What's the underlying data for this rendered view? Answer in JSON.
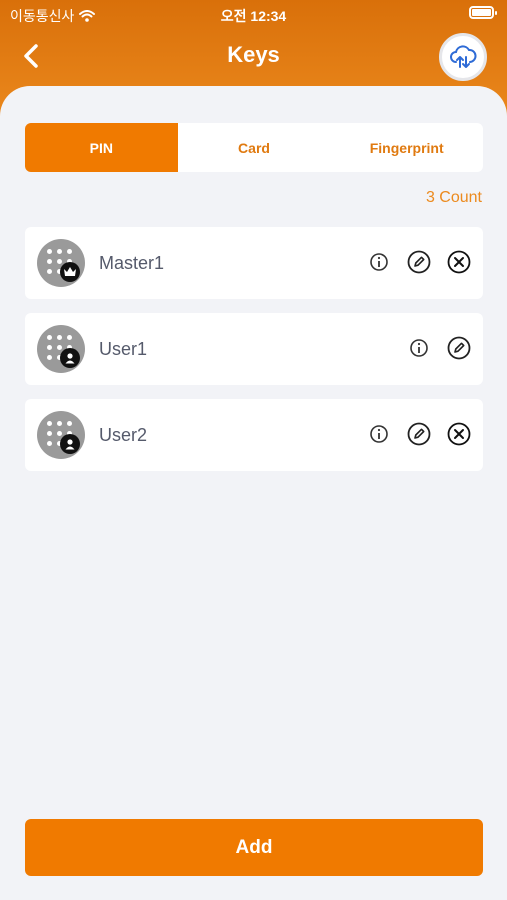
{
  "status_bar": {
    "carrier": "이동통신사",
    "time": "오전 12:34"
  },
  "header": {
    "title": "Keys"
  },
  "tabs": [
    {
      "label": "PIN",
      "active": true
    },
    {
      "label": "Card",
      "active": false
    },
    {
      "label": "Fingerprint",
      "active": false
    }
  ],
  "count_label": "3 Count",
  "keys": [
    {
      "name": "Master1",
      "badge_icon": "crown-icon",
      "actions": [
        "info-icon",
        "edit-icon",
        "delete-icon"
      ]
    },
    {
      "name": "User1",
      "badge_icon": "user-icon",
      "actions": [
        "info-icon",
        "edit-icon"
      ]
    },
    {
      "name": "User2",
      "badge_icon": "user-icon",
      "actions": [
        "info-icon",
        "edit-icon",
        "delete-icon"
      ]
    }
  ],
  "add_button_label": "Add",
  "colors": {
    "accent": "#f07a00",
    "header_top": "#d9700a",
    "header_bottom": "#ec8a1e",
    "background": "#f2f3f7"
  }
}
